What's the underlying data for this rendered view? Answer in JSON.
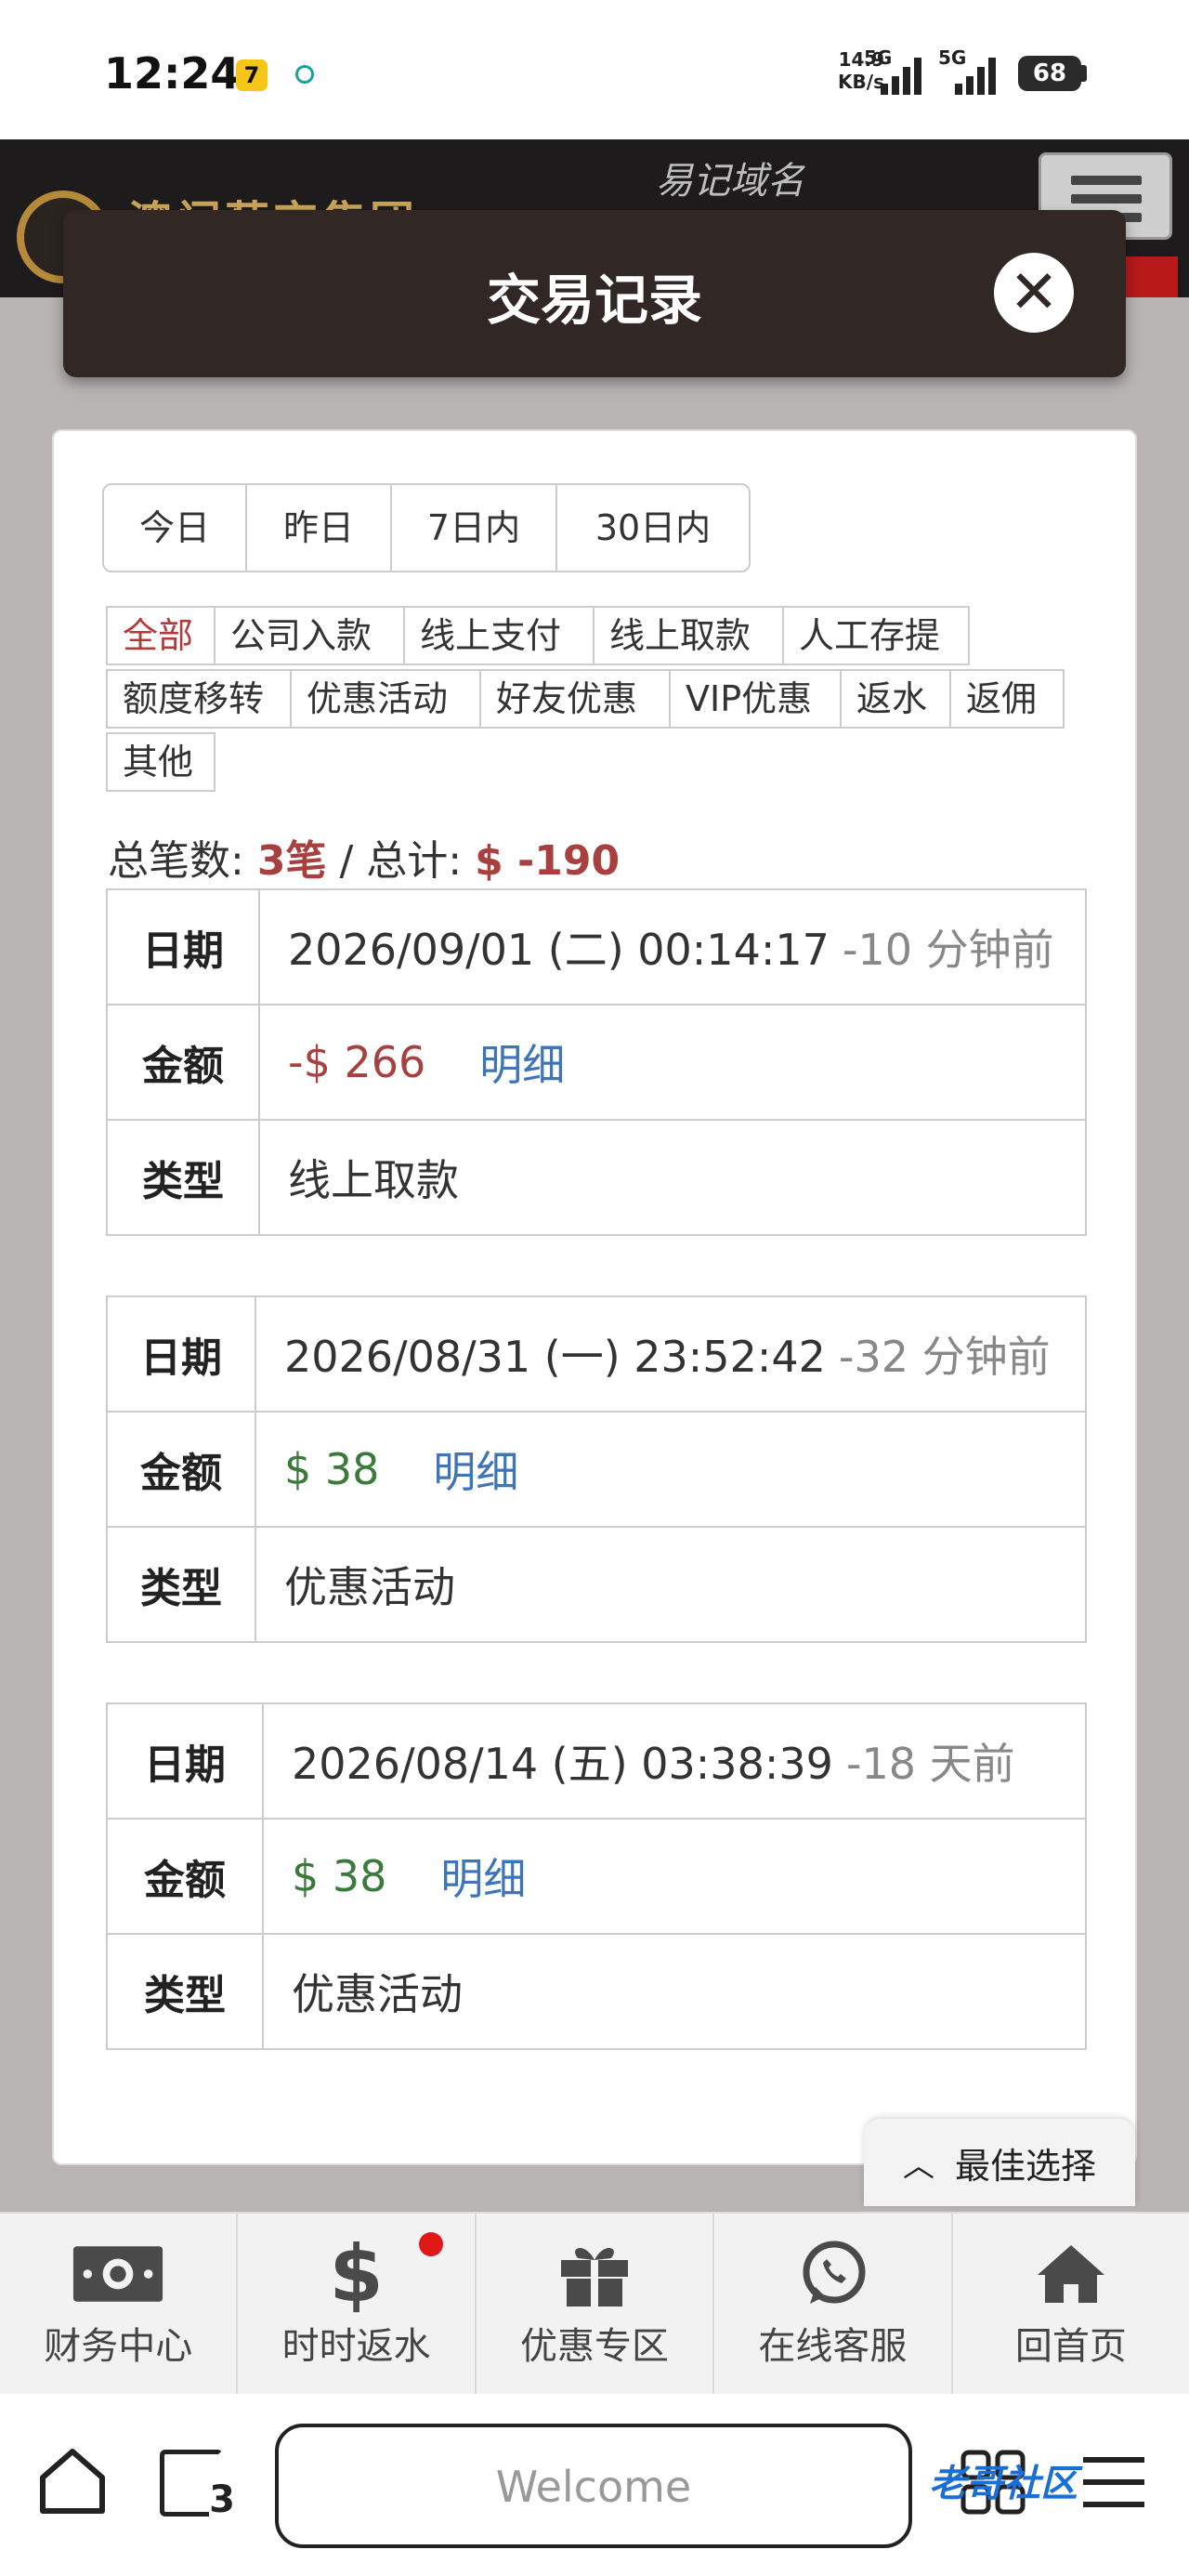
{
  "status_bar": {
    "time": "12:24",
    "net_speed_value": "14.9",
    "net_speed_unit": "KB/s",
    "sim1_label": "5G",
    "sim2_label": "5G",
    "battery": "68"
  },
  "site_header": {
    "logo_text": "澳门葡京集团",
    "title_fragment": "易记域名"
  },
  "modal": {
    "title": "交易记录"
  },
  "date_filters": [
    {
      "label": "今日",
      "active": false
    },
    {
      "label": "昨日",
      "active": false
    },
    {
      "label": "7日内",
      "active": false
    },
    {
      "label": "30日内",
      "active": true
    }
  ],
  "type_filters": [
    {
      "label": "全部",
      "active": true
    },
    {
      "label": "公司入款",
      "active": false
    },
    {
      "label": "线上支付",
      "active": false
    },
    {
      "label": "线上取款",
      "active": false
    },
    {
      "label": "人工存提",
      "active": false
    },
    {
      "label": "额度移转",
      "active": false
    },
    {
      "label": "优惠活动",
      "active": false
    },
    {
      "label": "好友优惠",
      "active": false
    },
    {
      "label": "VIP优惠",
      "active": false
    },
    {
      "label": "返水",
      "active": false
    },
    {
      "label": "返佣",
      "active": false
    },
    {
      "label": "其他",
      "active": false
    }
  ],
  "summary": {
    "count_label": "总笔数:",
    "count_value": "3笔",
    "separator": "/",
    "total_label": "总计:",
    "total_value": "$ -190"
  },
  "record_labels": {
    "date": "日期",
    "amount": "金额",
    "type": "类型",
    "detail_link": "明细"
  },
  "records": [
    {
      "date": "2026/09/01 (二) 00:14:17",
      "ago": "-10 分钟前",
      "amount": "-$ 266",
      "amount_sign": "negative",
      "type": "线上取款"
    },
    {
      "date": "2026/08/31 (一) 23:52:42",
      "ago": "-32 分钟前",
      "amount": "$ 38",
      "amount_sign": "positive",
      "type": "优惠活动"
    },
    {
      "date": "2026/08/14 (五) 03:38:39",
      "ago": "-18 天前",
      "amount": "$ 38",
      "amount_sign": "positive",
      "type": "优惠活动"
    }
  ],
  "best_choice": "最佳选择",
  "bottom_nav": [
    {
      "label": "财务中心",
      "icon": "money-icon"
    },
    {
      "label": "时时返水",
      "icon": "dollar-icon"
    },
    {
      "label": "优惠专区",
      "icon": "gift-icon"
    },
    {
      "label": "在线客服",
      "icon": "whatsapp-icon"
    },
    {
      "label": "回首页",
      "icon": "home-icon"
    }
  ],
  "browser": {
    "url_text": "Welcome",
    "tab_count": "3",
    "watermark": "老哥社区"
  },
  "colors": {
    "accent_red": "#a84040",
    "positive_green": "#3c7a3c",
    "link_blue": "#3e75b8",
    "modal_header": "#312826"
  }
}
